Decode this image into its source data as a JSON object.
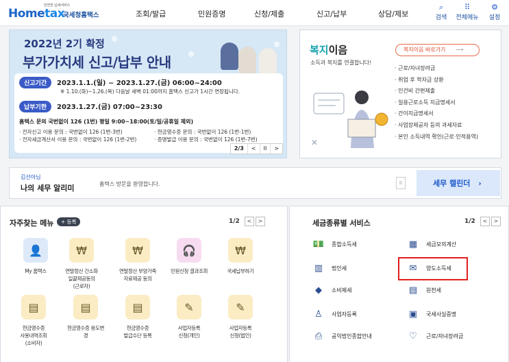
{
  "header": {
    "logo_tag": "안전한 납세서비스",
    "logo_main_1": "Home",
    "logo_main_2": "tax",
    "logo_sub": "국세청홈택스",
    "nav": [
      "조회/발급",
      "민원증명",
      "신청/제출",
      "신고/납부",
      "상담/제보"
    ],
    "utils": [
      {
        "label": "검색",
        "icon": "search-icon"
      },
      {
        "label": "전체메뉴",
        "icon": "grid-icon"
      },
      {
        "label": "설정",
        "icon": "gear-icon"
      }
    ]
  },
  "banner": {
    "title1": "2022년 2기 확정",
    "title2": "부가가치세 신고/납부 안내",
    "period_pill": "신고기간",
    "period_text": "2023.1.1.(일) ~ 2023.1.27.(금) 06:00~24:00",
    "period_note": "※ 1.10.(화)~1.26.(목) 다음날 새벽 01:00까지 홈택스 신고가 1시간 연장됩니다.",
    "due_pill": "납부기한",
    "due_text": "2023.1.27.(금) 07:00~23:30",
    "call_text": "홈택스 문의 국번없이 126 (1번) 평일 9:00~18:00(토/일/공휴일 제외)",
    "small_1": "· 전자신고 이용 문의 : 국번없이 126 (1번-3번)",
    "small_2": "· 현금영수증 문의 : 국번없이 126 (1번-1번)",
    "small_3": "· 전자세금계산서 이용 문의 : 국번없이 126 (1번-2번)",
    "small_4": "· 증명발급 이용 문의 : 국번없이 126 (1번-7번)",
    "page": "2/3",
    "prev": "<",
    "pause": "II",
    "next": ">"
  },
  "welfare": {
    "title_accent": "복지",
    "title_rest": "이음",
    "subtitle": "소득과 복지를 연결합니다!",
    "button": "복지이음 바로가기",
    "button_arrow": "⟶",
    "items": [
      "· 근로/자녀장려금",
      "· 취업 후 학자금 상환",
      "· 인건비 간편제출",
      "· 일용근로소득 지급명세서",
      "· 간이지급명세서",
      "· 사업장제공자 등의 과세자료",
      "· 본인 소득내역 확인(근로·인적용역)"
    ]
  },
  "notice": {
    "name": "김선아님",
    "title": "나의 세무 알리미",
    "message": "홈택스 방문을 환영합니다.",
    "pause": "II",
    "calendar": "세무 캘린더",
    "calendar_arrow": "›"
  },
  "favorites": {
    "title": "자주찾는 메뉴",
    "add": "+ 등록",
    "page": "1/2",
    "prev": "<",
    "next": ">",
    "items": [
      {
        "label": "My 홈택스",
        "icon": "person-icon",
        "color": "#dde9f8"
      },
      {
        "label": "연말정산 간소화\n일괄제공동의\n(근로자)",
        "icon": "moneybag-icon",
        "color": "#fbecc4"
      },
      {
        "label": "연말정산 부양가족\n자료제공 동의",
        "icon": "moneybag-icon",
        "color": "#fbecc4"
      },
      {
        "label": "민원신청 결과조회",
        "icon": "headset-icon",
        "color": "#f7dcf1"
      },
      {
        "label": "국세납부하기",
        "icon": "moneybag-icon",
        "color": "#fbecc4"
      },
      {
        "label": "현금영수증\n사용내역조회\n(소비자)",
        "icon": "receipt-icon",
        "color": "#fbecc4"
      },
      {
        "label": "현금영수증 용도변\n경",
        "icon": "receipt-icon",
        "color": "#fbecc4"
      },
      {
        "label": "현금영수증\n발급수단 등록",
        "icon": "receipt-icon",
        "color": "#fbecc4"
      },
      {
        "label": "사업자등록\n신청(개인)",
        "icon": "user-edit-icon",
        "color": "#fbecc4"
      },
      {
        "label": "사업자등록\n신청(법인)",
        "icon": "user-edit-icon",
        "color": "#fbecc4"
      }
    ]
  },
  "taxes": {
    "title": "세금종류별 서비스",
    "page": "1/2",
    "prev": "<",
    "next": ">",
    "items": [
      {
        "label": "종합소득세",
        "icon": "money-icon"
      },
      {
        "label": "세금모의계산",
        "icon": "calculator-icon"
      },
      {
        "label": "법인세",
        "icon": "building-icon"
      },
      {
        "label": "양도소득세",
        "icon": "document-icon"
      },
      {
        "label": "소비제세",
        "icon": "diamond-icon"
      },
      {
        "label": "원천세",
        "icon": "ledger-icon"
      },
      {
        "label": "사업자등록",
        "icon": "person-icon"
      },
      {
        "label": "국세사실증명",
        "icon": "certificate-icon"
      },
      {
        "label": "공익법인종합안내",
        "icon": "charity-icon"
      },
      {
        "label": "근로/자녀장려금",
        "icon": "heart-icon"
      }
    ],
    "highlight_color": "#e21d1d"
  }
}
